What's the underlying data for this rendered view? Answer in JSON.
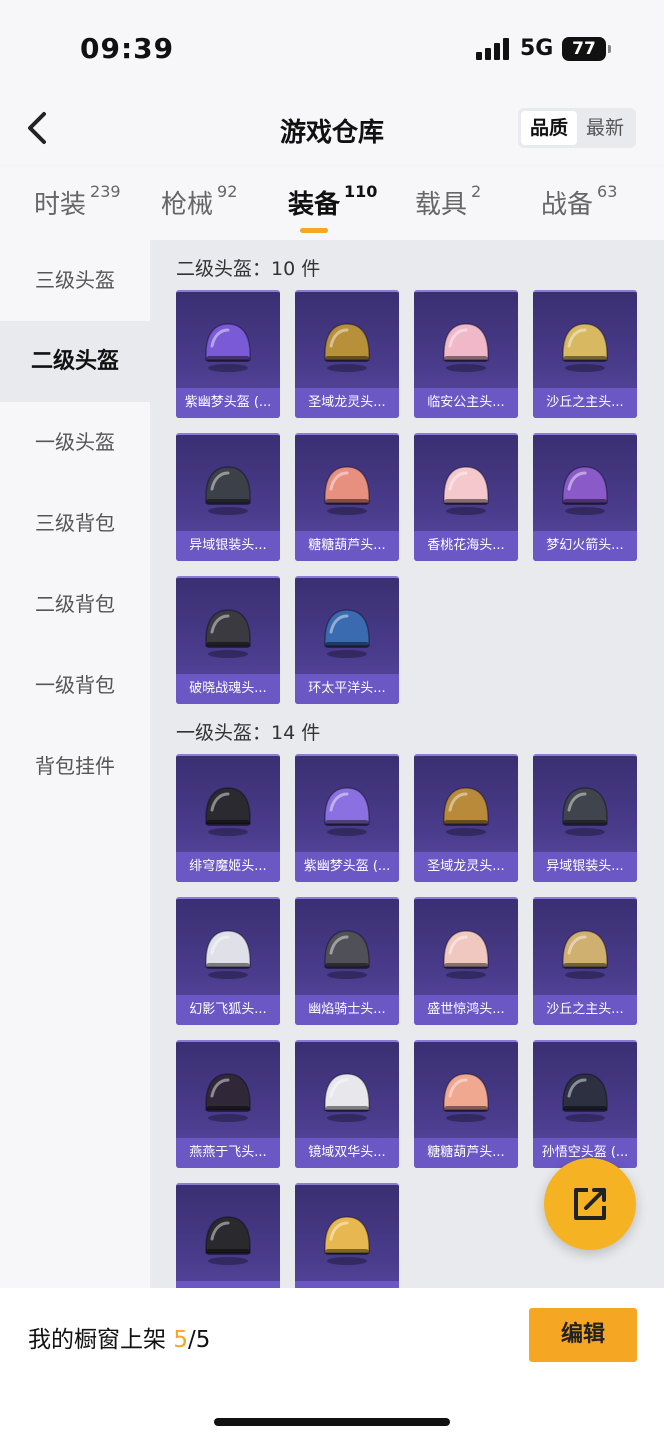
{
  "status_bar": {
    "time": "09:39",
    "network": "5G",
    "battery": "77"
  },
  "header": {
    "title": "游戏仓库",
    "sort_options": [
      "品质",
      "最新"
    ],
    "sort_selected": "品质"
  },
  "tabs": [
    {
      "label": "时装",
      "count": "239"
    },
    {
      "label": "枪械",
      "count": "92"
    },
    {
      "label": "装备",
      "count": "110"
    },
    {
      "label": "载具",
      "count": "2"
    },
    {
      "label": "战备",
      "count": "63"
    }
  ],
  "active_tab": "装备",
  "sidebar": {
    "items": [
      "三级头盔",
      "二级头盔",
      "一级头盔",
      "三级背包",
      "二级背包",
      "一级背包",
      "背包挂件"
    ],
    "active": "二级头盔"
  },
  "sections": [
    {
      "title": "二级头盔：10 件",
      "items": [
        {
          "name": "紫幽梦头盔 (...",
          "color": "#7b5ad8"
        },
        {
          "name": "圣域龙灵头...",
          "color": "#b8903a"
        },
        {
          "name": "临安公主头...",
          "color": "#f0b8c8"
        },
        {
          "name": "沙丘之主头...",
          "color": "#d8b860"
        },
        {
          "name": "异域银装头...",
          "color": "#3c4048"
        },
        {
          "name": "糖糖葫芦头...",
          "color": "#e89080"
        },
        {
          "name": "香桃花海头...",
          "color": "#f4c8cc"
        },
        {
          "name": "梦幻火箭头...",
          "color": "#8a5ac8"
        },
        {
          "name": "破晓战魂头...",
          "color": "#3a3a40"
        },
        {
          "name": "环太平洋头...",
          "color": "#3a6ab0"
        }
      ]
    },
    {
      "title": "一级头盔：14 件",
      "items": [
        {
          "name": "绯穹魔姬头...",
          "color": "#2a2a30"
        },
        {
          "name": "紫幽梦头盔 (...",
          "color": "#8a70e0"
        },
        {
          "name": "圣域龙灵头...",
          "color": "#b88a3a"
        },
        {
          "name": "异域银装头...",
          "color": "#40444c"
        },
        {
          "name": "幻影飞狐头...",
          "color": "#e0e0e8"
        },
        {
          "name": "幽焰骑士头...",
          "color": "#505058"
        },
        {
          "name": "盛世惊鸿头...",
          "color": "#f0c8c0"
        },
        {
          "name": "沙丘之主头...",
          "color": "#d0b070"
        },
        {
          "name": "燕燕于飞头...",
          "color": "#302838"
        },
        {
          "name": "镜域双华头...",
          "color": "#e8e8ec"
        },
        {
          "name": "糖糖葫芦头...",
          "color": "#f0a890"
        },
        {
          "name": "孙悟空头盔 (...",
          "color": "#2c3040"
        },
        {
          "name": "",
          "color": "#2a2a2e"
        },
        {
          "name": "",
          "color": "#e8b850"
        }
      ]
    }
  ],
  "bottom_bar": {
    "label": "我的橱窗上架",
    "current": "5",
    "total": "/5",
    "edit": "编辑"
  }
}
